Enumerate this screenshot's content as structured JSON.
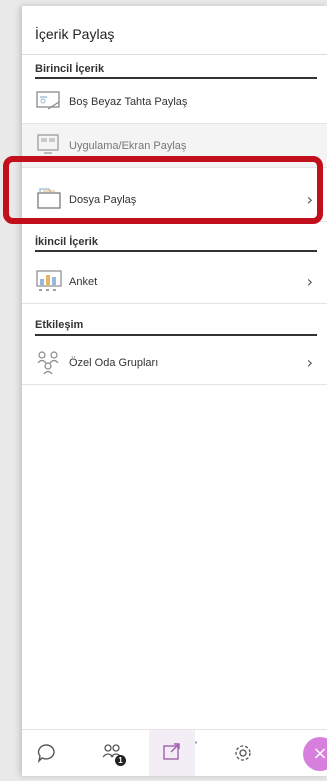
{
  "panel": {
    "title": "İçerik Paylaş"
  },
  "sections": {
    "primary": {
      "heading": "Birincil İçerik",
      "items": [
        {
          "label": "Boş Beyaz Tahta Paylaş",
          "icon": "whiteboard-icon"
        },
        {
          "label": "Uygulama/Ekran Paylaş",
          "icon": "screen-share-icon",
          "disabled": true
        },
        {
          "label": "Dosya Paylaş",
          "icon": "folder-icon",
          "chevron": "›"
        }
      ]
    },
    "secondary": {
      "heading": "İkincil İçerik",
      "items": [
        {
          "label": "Anket",
          "icon": "poll-icon",
          "chevron": "›"
        }
      ]
    },
    "interaction": {
      "heading": "Etkileşim",
      "items": [
        {
          "label": "Özel Oda Grupları",
          "icon": "breakout-groups-icon",
          "chevron": "›"
        }
      ]
    }
  },
  "bottom_bar": {
    "attendees_badge": "1",
    "close_glyph": "×",
    "icons": [
      "chat-icon",
      "attendees-icon",
      "share-content-icon",
      "settings-icon",
      "close-icon"
    ]
  },
  "colors": {
    "highlight_border": "#c10f1c",
    "close_button": "#d67fdc",
    "active_tab_bg": "#f3eef6"
  }
}
